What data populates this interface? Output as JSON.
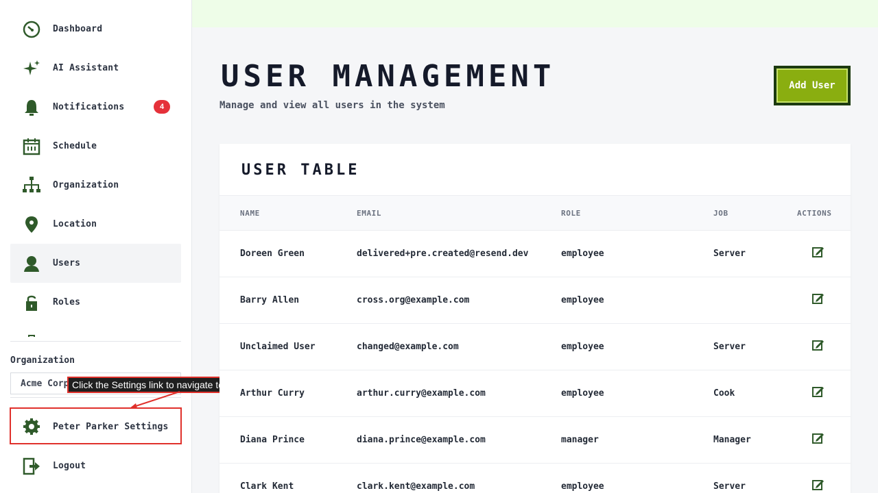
{
  "sidebar": {
    "items": [
      {
        "label": "Dashboard",
        "icon": "dashboard-icon"
      },
      {
        "label": "AI Assistant",
        "icon": "sparkle-icon"
      },
      {
        "label": "Notifications",
        "icon": "bell-icon",
        "badge": "4"
      },
      {
        "label": "Schedule",
        "icon": "calendar-icon"
      },
      {
        "label": "Organization",
        "icon": "org-chart-icon"
      },
      {
        "label": "Location",
        "icon": "location-pin-icon"
      },
      {
        "label": "Users",
        "icon": "user-icon",
        "active": true
      },
      {
        "label": "Roles",
        "icon": "unlock-icon"
      }
    ],
    "organization_label": "Organization",
    "organization_value": "Acme Corp",
    "settings_label": "Peter Parker Settings",
    "logout_label": "Logout"
  },
  "tooltip": {
    "text": "Click the Settings link to navigate to user settings"
  },
  "header": {
    "title": "USER MANAGEMENT",
    "subtitle": "Manage and view all users in the system",
    "add_button": "Add User"
  },
  "table": {
    "title": "USER TABLE",
    "columns": [
      "NAME",
      "EMAIL",
      "ROLE",
      "JOB",
      "ACTIONS"
    ],
    "rows": [
      {
        "name": "Doreen Green",
        "email": "delivered+pre.created@resend.dev",
        "role": "employee",
        "job": "Server"
      },
      {
        "name": "Barry Allen",
        "email": "cross.org@example.com",
        "role": "employee",
        "job": ""
      },
      {
        "name": "Unclaimed User",
        "email": "changed@example.com",
        "role": "employee",
        "job": "Server"
      },
      {
        "name": "Arthur Curry",
        "email": "arthur.curry@example.com",
        "role": "employee",
        "job": "Cook"
      },
      {
        "name": "Diana Prince",
        "email": "diana.prince@example.com",
        "role": "manager",
        "job": "Manager"
      },
      {
        "name": "Clark Kent",
        "email": "clark.kent@example.com",
        "role": "employee",
        "job": "Server"
      }
    ]
  },
  "colors": {
    "accent": "#8aae10",
    "icon": "#2f5a2a",
    "badge": "#e5313a",
    "topbar": "#eefde8"
  }
}
